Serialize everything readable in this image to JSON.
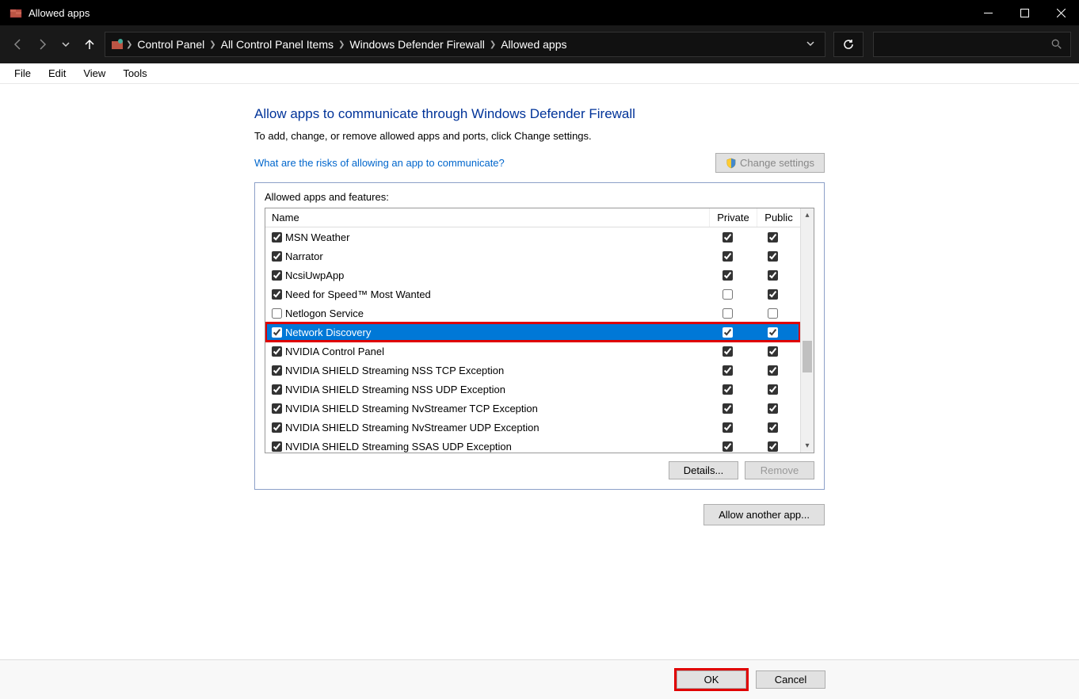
{
  "titlebar": {
    "title": "Allowed apps"
  },
  "breadcrumb": {
    "seg1": "Control Panel",
    "seg2": "All Control Panel Items",
    "seg3": "Windows Defender Firewall",
    "seg4": "Allowed apps"
  },
  "menu": {
    "file": "File",
    "edit": "Edit",
    "view": "View",
    "tools": "Tools"
  },
  "heading": "Allow apps to communicate through Windows Defender Firewall",
  "subtext": "To add, change, or remove allowed apps and ports, click Change settings.",
  "risk_link": "What are the risks of allowing an app to communicate?",
  "change_settings": "Change settings",
  "panel_title": "Allowed apps and features:",
  "columns": {
    "name": "Name",
    "private": "Private",
    "public": "Public"
  },
  "rows": [
    {
      "name": "MSN Weather",
      "enabled": true,
      "private": true,
      "public": true,
      "selected": false
    },
    {
      "name": "Narrator",
      "enabled": true,
      "private": true,
      "public": true,
      "selected": false
    },
    {
      "name": "NcsiUwpApp",
      "enabled": true,
      "private": true,
      "public": true,
      "selected": false
    },
    {
      "name": "Need for Speed™ Most Wanted",
      "enabled": true,
      "private": false,
      "public": true,
      "selected": false
    },
    {
      "name": "Netlogon Service",
      "enabled": false,
      "private": false,
      "public": false,
      "selected": false
    },
    {
      "name": "Network Discovery",
      "enabled": true,
      "private": true,
      "public": true,
      "selected": true
    },
    {
      "name": "NVIDIA Control Panel",
      "enabled": true,
      "private": true,
      "public": true,
      "selected": false
    },
    {
      "name": "NVIDIA SHIELD Streaming NSS TCP Exception",
      "enabled": true,
      "private": true,
      "public": true,
      "selected": false
    },
    {
      "name": "NVIDIA SHIELD Streaming NSS UDP Exception",
      "enabled": true,
      "private": true,
      "public": true,
      "selected": false
    },
    {
      "name": "NVIDIA SHIELD Streaming NvStreamer TCP Exception",
      "enabled": true,
      "private": true,
      "public": true,
      "selected": false
    },
    {
      "name": "NVIDIA SHIELD Streaming NvStreamer UDP Exception",
      "enabled": true,
      "private": true,
      "public": true,
      "selected": false
    },
    {
      "name": "NVIDIA SHIELD Streaming SSAS UDP Exception",
      "enabled": true,
      "private": true,
      "public": true,
      "selected": false
    }
  ],
  "details_btn": "Details...",
  "remove_btn": "Remove",
  "allow_another": "Allow another app...",
  "ok": "OK",
  "cancel": "Cancel"
}
